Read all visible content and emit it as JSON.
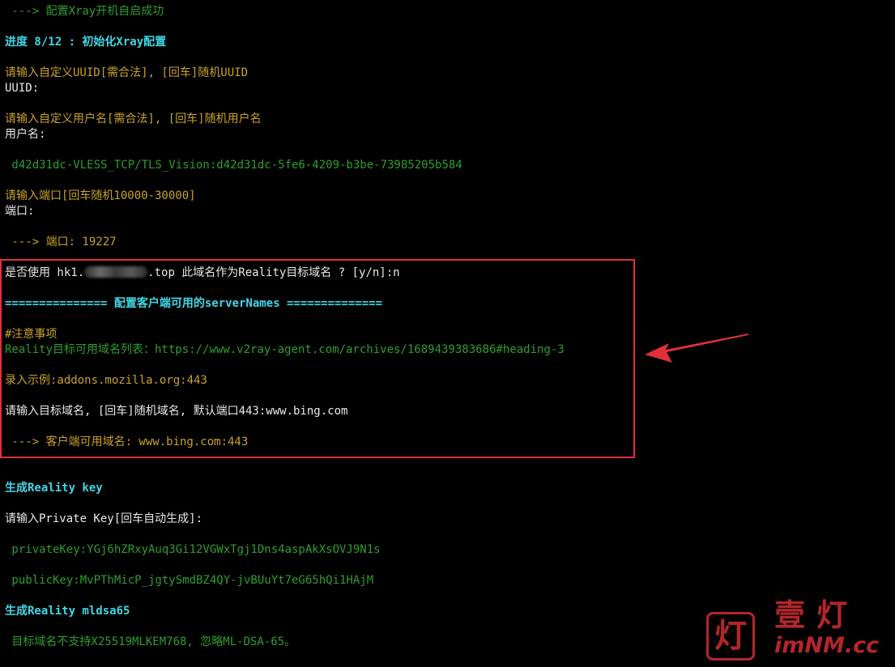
{
  "terminal": {
    "lines": {
      "l01": " ---> 配置Xray开机自启成功",
      "l02": "进度 8/12 : 初始化Xray配置",
      "l03": "请输入自定义UUID[需合法], [回车]随机UUID",
      "l04": "UUID:",
      "l05": "请输入自定义用户名[需合法], [回车]随机用户名",
      "l06": "用户名:",
      "l07": " d42d31dc-VLESS_TCP/TLS_Vision:d42d31dc-5fe6-4209-b3be-73985205b584",
      "l08": "请输入端口[回车随机10000-30000]",
      "l09": "端口:",
      "l10": " ---> 端口: 19227",
      "l11a": "是否使用 hk1.",
      "l11b": ".top 此域名作为Reality目标域名 ? [y/n]:n",
      "l12": "=============== 配置客户端可用的serverNames ==============",
      "l13": "#注意事项",
      "l14": "Reality目标可用域名列表：https://www.v2ray-agent.com/archives/1689439383686#heading-3",
      "l15": "录入示例:addons.mozilla.org:443",
      "l16": "请输入目标域名, [回车]随机域名, 默认端口443:www.bing.com",
      "l17": " ---> 客户端可用域名: www.bing.com:443",
      "l18": "生成Reality key",
      "l19": "请输入Private Key[回车自动生成]:",
      "l20": " privateKey:YGj6hZRxyAuq3Gi12VGWxTgj1Dns4aspAkXsOVJ9N1s",
      "l21": " publicKey:MvPThMicP_jgtySmdBZ4QY-jvBUuYt7eG65hQi1HAjM",
      "l22": "生成Reality mldsa65",
      "l23": " 目标域名不支持X25519MLKEM768, 忽略ML-DSA-65。"
    }
  },
  "watermark": {
    "stamp_char": "灯",
    "chars": "壹灯",
    "domain": "imNM.cc"
  },
  "colors": {
    "background": "#000000",
    "success_green": "#2e9e2e",
    "prompt_yellow": "#c9a227",
    "heading_cyan": "#3fd7e6",
    "default_text": "#e8e8e8",
    "highlight_red": "#e0303a",
    "watermark_red": "#b3262a"
  },
  "icons": {
    "annotation_arrow": "arrow-left-icon",
    "redacted_domain": "blur-redaction"
  }
}
